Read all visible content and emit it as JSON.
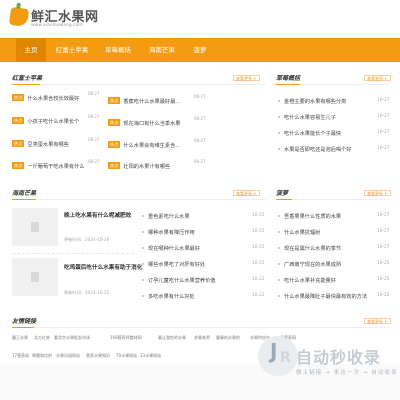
{
  "header": {
    "logo_text": "鲜汇水果网",
    "logo_domain": "www.xianhuiwang.com"
  },
  "nav": [
    {
      "label": "主页"
    },
    {
      "label": "红富士苹果"
    },
    {
      "label": "草莓概括"
    },
    {
      "label": "海南芒果"
    },
    {
      "label": "菠萝"
    }
  ],
  "more_label": "查看更多 +",
  "sections": {
    "apple": {
      "title": "红富士苹果",
      "badge": "热点",
      "left": [
        {
          "text": "什么水果含较长效最好",
          "date": "08-27"
        },
        {
          "text": "小孩子吃什么水果长个",
          "date": "08-27"
        },
        {
          "text": "豆类蛋水果有哪些",
          "date": "08-27"
        },
        {
          "text": "一斤葡萄干吃水果有什么",
          "date": "08-27"
        }
      ],
      "right": [
        {
          "text": "香蕉吃什么水果最好最...",
          "date": "08-27"
        },
        {
          "text": "现在海口有什么当季水果",
          "date": "08-27"
        },
        {
          "text": "什么水果会有维生素含...",
          "date": "08-27"
        },
        {
          "text": "壮阳的水果汁有哪些",
          "date": "08-27"
        }
      ]
    },
    "strawberry": {
      "title": "草莓概括",
      "items": [
        {
          "text": "金橙主要的水果有哪些分类",
          "date": "10-27"
        },
        {
          "text": "吃什么水果容易生儿子",
          "date": "10-27"
        },
        {
          "text": "吃什么水果能长个子最快",
          "date": "10-27"
        },
        {
          "text": "水果是否即吃还是泡后喝个好",
          "date": "10-27"
        }
      ]
    },
    "mango": {
      "title": "海南芒果",
      "articles": [
        {
          "title": "晚上吃水果有什么呢减肥效",
          "date": "更新时间：2024-10-26"
        },
        {
          "title": "吃鸡蛋后吃什么水果有助于消化",
          "date": "更新时间：2024-10-25"
        }
      ],
      "items": [
        {
          "text": "重色素吃什么水果",
          "date": "10-25"
        },
        {
          "text": "哪种水果有降压作用",
          "date": "10-25"
        },
        {
          "text": "现在哪种什么水果最好",
          "date": "10-25"
        },
        {
          "text": "哪些水果吃了对肝有好处",
          "date": "10-25"
        },
        {
          "text": "订孕儿童吃什么水果营养价值",
          "date": "10-22"
        },
        {
          "text": "多吃水果有什么好处",
          "date": "10-22"
        }
      ]
    },
    "pineapple": {
      "title": "菠萝",
      "items": [
        {
          "text": "吾香果果什么性质的水果",
          "date": "10-27"
        },
        {
          "text": "什么水果抗辐射",
          "date": "10-27"
        },
        {
          "text": "现在是属什么水果的季节",
          "date": "10-27"
        },
        {
          "text": "广西南宁现在的水果成熟",
          "date": "10-25"
        },
        {
          "text": "吃什么水果补充能量好",
          "date": "10-25"
        },
        {
          "text": "什么水果最降肚子最快最有效的方法",
          "date": "10-22"
        }
      ]
    }
  },
  "friendly_links": {
    "title": "友情链接",
    "links": [
      "霸王水果",
      "北方红茶",
      "看北京水果批发市场",
      "168营养师食材网",
      "最让我吃的水果",
      "苏果老师",
      "健康的水果的",
      "水果供应市",
      "水果营养网"
    ],
    "links2": [
      "77营养网",
      "果酸和饮剂",
      "水果乐园网站",
      "营养水果知识",
      "70水果网站",
      "23水果网站"
    ]
  },
  "watermark": {
    "text": "自动秒收录",
    "subtitle": "做上链接 → 来访一次 → 自动收录"
  }
}
